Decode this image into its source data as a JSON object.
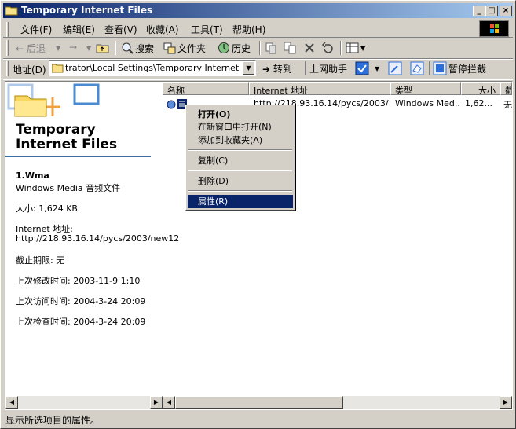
{
  "window": {
    "title": "Temporary Internet Files"
  },
  "caption_buttons": {
    "minimize": "_",
    "maximize": "□",
    "close": "×"
  },
  "menu": {
    "items": [
      {
        "label": "文件(F)"
      },
      {
        "label": "编辑(E)"
      },
      {
        "label": "查看(V)"
      },
      {
        "label": "收藏(A)"
      },
      {
        "label": "工具(T)"
      },
      {
        "label": "帮助(H)"
      }
    ]
  },
  "toolbar": {
    "back": "← 后退",
    "forward": "→",
    "search": "搜索",
    "folders": "文件夹",
    "history": "历史"
  },
  "address": {
    "label": "地址(D)",
    "value": "trator\\Local Settings\\Temporary Internet Files",
    "go": "转到",
    "links": "上网助手",
    "block": "暂停拦截"
  },
  "webview": {
    "title": "Temporary Internet Files",
    "file_name": "1.Wma",
    "file_type": "Windows Media 音频文件",
    "size_line": "大小: 1,624 KB",
    "url_label": "Internet 地址:",
    "url_value": "http://218.93.16.14/pycs/2003/new12",
    "expire": "截止期限: 无",
    "modified": "上次修改时间: 2003-11-9 1:10",
    "accessed": "上次访问时间: 2004-3-24 20:09",
    "checked": "上次检查时间: 2004-3-24 20:09"
  },
  "list": {
    "columns": [
      "名称",
      "Internet 地址",
      "类型",
      "大小",
      "截"
    ],
    "row": {
      "url": "http://218.93.16.14/pycs/2003/...",
      "type": "Windows Med...",
      "size": "1,62...",
      "expire": "无"
    }
  },
  "context_menu": {
    "items": [
      {
        "label": "打开(O)"
      },
      {
        "label": "在新窗口中打开(N)"
      },
      {
        "label": "添加到收藏夹(A)"
      },
      {
        "label": "复制(C)"
      },
      {
        "label": "删除(D)"
      },
      {
        "label": "属性(R)"
      }
    ]
  },
  "status": {
    "text": "显示所选项目的属性。"
  },
  "colors": {
    "title_start": "#0a246a",
    "title_end": "#a6caf0",
    "selection": "#0a246a",
    "chrome": "#d4d0c8"
  }
}
